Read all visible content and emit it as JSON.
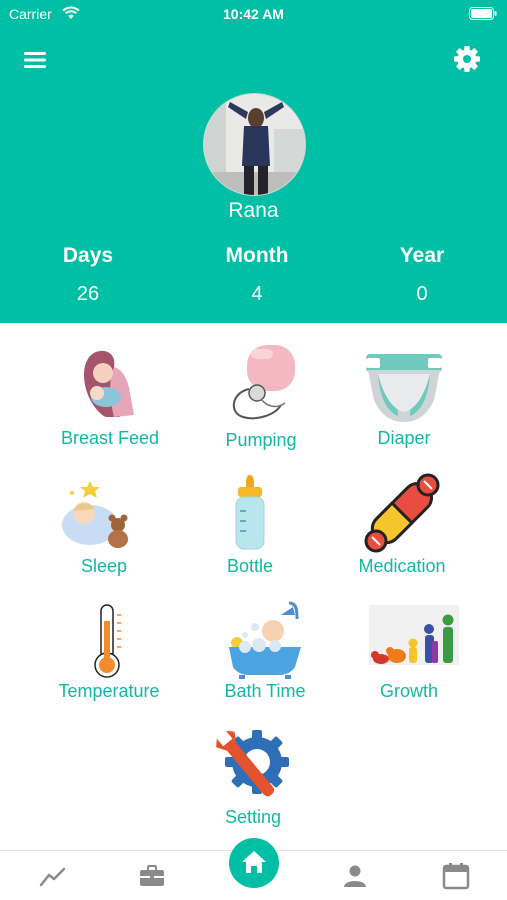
{
  "status_bar": {
    "carrier": "Carrier",
    "time": "10:42 AM"
  },
  "header": {
    "menu_icon": "hamburger-menu-icon",
    "settings_icon": "gear-icon",
    "profile_name": "Rana",
    "accent_color": "#00bfa5"
  },
  "age": {
    "days_label": "Days",
    "days_value": "26",
    "month_label": "Month",
    "month_value": "4",
    "year_label": "Year",
    "year_value": "0"
  },
  "activities": [
    {
      "label": "Breast Feed",
      "icon": "breastfeeding-icon"
    },
    {
      "label": "Pumping",
      "icon": "breast-pump-icon"
    },
    {
      "label": "Diaper",
      "icon": "diaper-icon"
    },
    {
      "label": "Sleep",
      "icon": "sleeping-baby-icon"
    },
    {
      "label": "Bottle",
      "icon": "baby-bottle-icon"
    },
    {
      "label": "Medication",
      "icon": "pills-icon"
    },
    {
      "label": "Temperature",
      "icon": "thermometer-icon"
    },
    {
      "label": "Bath Time",
      "icon": "bathtub-icon"
    },
    {
      "label": "Growth",
      "icon": "growth-children-icon"
    },
    {
      "label": "Setting",
      "icon": "wrench-gear-icon"
    }
  ],
  "tabbar": {
    "tabs": [
      "trend-chart-icon",
      "briefcase-icon",
      "home-icon",
      "person-icon",
      "calendar-icon"
    ],
    "active": "home-icon"
  }
}
